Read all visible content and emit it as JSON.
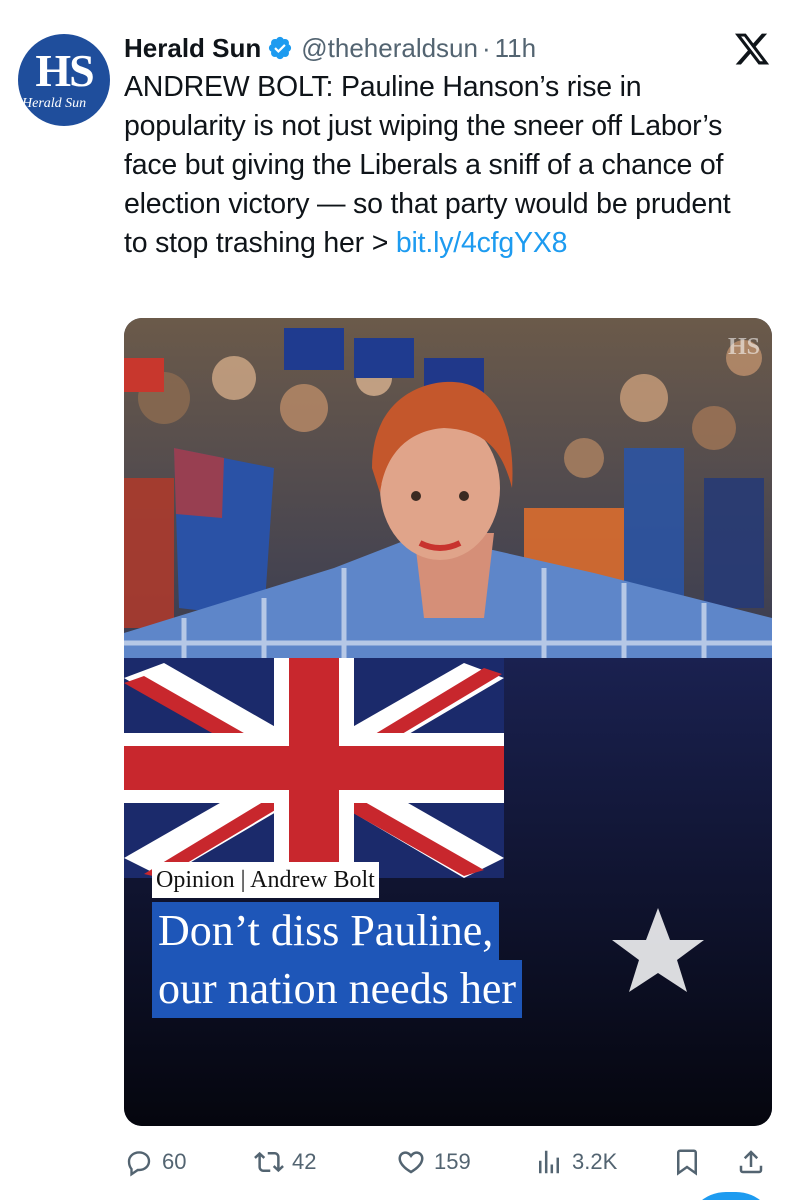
{
  "tweet": {
    "avatar_text": "HS",
    "avatar_subtext": "Herald Sun",
    "display_name": "Herald Sun",
    "handle": "@theheraldsun",
    "separator": "·",
    "time": "11h",
    "text": "ANDREW BOLT: Pauline Hanson’s rise in popularity is not just wiping the sneer off Labor’s face but giving the Liberals a sniff of a chance of election victory — so that party would be prudent to stop trashing her > ",
    "link": "bit.ly/4cfgYX8"
  },
  "media": {
    "watermark": "HS",
    "category": "Opinion | Andrew Bolt",
    "headline_line1": "Don’t diss Pauline,",
    "headline_line2": "our nation needs her"
  },
  "actions": {
    "replies": "60",
    "reposts": "42",
    "likes": "159",
    "views": "3.2K"
  },
  "colors": {
    "brand_blue": "#1f4e9c",
    "link": "#1d9bf0",
    "muted": "#536471",
    "headline_bg": "#1e56b8"
  },
  "icons": [
    "verified-badge-icon",
    "x-logo-icon",
    "reply-icon",
    "repost-icon",
    "like-icon",
    "views-icon",
    "bookmark-icon",
    "share-icon"
  ]
}
